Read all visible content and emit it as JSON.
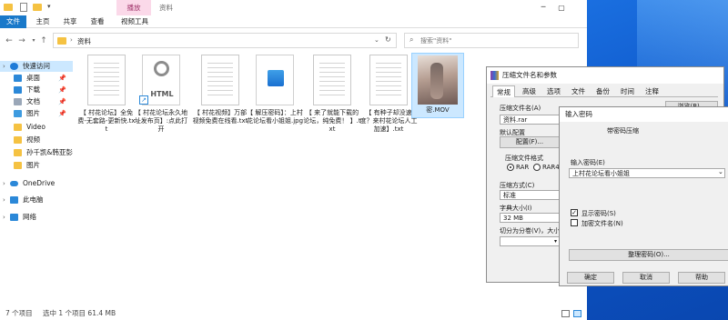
{
  "explorer": {
    "title": "资料",
    "playback_tab": "播放",
    "ribbon_tabs": [
      "文件",
      "主页",
      "共享",
      "查看",
      "视频工具"
    ],
    "breadcrumb": "资料",
    "search_placeholder": "搜索\"资料\"",
    "sidebar": [
      {
        "label": "快速访问",
        "icon": "star-icon",
        "color": "#1e7bd8",
        "pinned": false
      },
      {
        "label": "桌面",
        "icon": "desktop-icon",
        "color": "#2b88d8",
        "pinned": true
      },
      {
        "label": "下载",
        "icon": "download-icon",
        "color": "#2b88d8",
        "pinned": true
      },
      {
        "label": "文档",
        "icon": "documents-icon",
        "color": "#9aa7b8",
        "pinned": true
      },
      {
        "label": "图片",
        "icon": "pictures-icon",
        "color": "#3e9be0",
        "pinned": true
      },
      {
        "label": "Video",
        "icon": "folder-icon",
        "color": "#f5c242",
        "pinned": false
      },
      {
        "label": "视频",
        "icon": "folder-icon",
        "color": "#f5c242",
        "pinned": false
      },
      {
        "label": "孙千凯&韩亚彭",
        "icon": "folder-icon",
        "color": "#f5c242",
        "pinned": false
      },
      {
        "label": "图片",
        "icon": "folder-icon",
        "color": "#f5c242",
        "pinned": false
      },
      {
        "label": "OneDrive",
        "icon": "onedrive-icon",
        "color": "#2b88d8",
        "pinned": false
      },
      {
        "label": "此电脑",
        "icon": "this-pc-icon",
        "color": "#2b88d8",
        "pinned": false
      },
      {
        "label": "网络",
        "icon": "network-icon",
        "color": "#2b88d8",
        "pinned": false
      }
    ],
    "files": [
      {
        "name": "【 村花论坛】全免费-无套路-更新快.txt",
        "type": "txt"
      },
      {
        "name": "【 村花论坛永久地址发布页】:点此打开",
        "type": "html",
        "badge": "HTML"
      },
      {
        "name": "【 村花视频】万部视频免费在线看.txt",
        "type": "txt"
      },
      {
        "name": "【 解压密码】：上村花论坛看小姐姐.jpg",
        "type": "jpg"
      },
      {
        "name": "【 来了就能下载的论坛，纯免费！ 】.txt",
        "type": "txt"
      },
      {
        "name": "【 有种子却没速度？来村花论坛人工加速】.txt",
        "type": "txt"
      },
      {
        "name": "密.MOV",
        "type": "mov"
      }
    ],
    "status": {
      "count": "7 个项目",
      "selected": "选中 1 个项目  61.4 MB"
    }
  },
  "winrar_dialog": {
    "title": "压缩文件名和参数",
    "tabs": [
      "常规",
      "高级",
      "选项",
      "文件",
      "备份",
      "时间",
      "注释"
    ],
    "archive_name_label": "压缩文件名(A)",
    "archive_name_value": "资料.rar",
    "browse_button": "浏览(B)...",
    "default_profile_label": "默认配置",
    "profiles_button": "配置(F)...",
    "format_label": "压缩文件格式",
    "format_options": [
      "RAR",
      "RAR4"
    ],
    "format_selected": "RAR",
    "method_label": "压缩方式(C)",
    "method_value": "标准",
    "dict_label": "字典大小(I)",
    "dict_value": "32 MB",
    "split_label": "切分为分卷(V)，大小"
  },
  "password_dialog": {
    "title": "输入密码",
    "heading": "带密码压缩",
    "enter_label": "输入密码(E)",
    "password_value": "上村花论坛看小姐姐",
    "show_password_label": "显示密码(S)",
    "show_password_checked": true,
    "encrypt_names_label": "加密文件名(N)",
    "encrypt_names_checked": false,
    "organize_button": "整理密码(O)...",
    "ok_button": "确定",
    "cancel_button": "取消",
    "help_button": "帮助"
  },
  "colors": {
    "desktop": "#0a5fd0",
    "ribbon_file_tab": "#1979ca",
    "contextual_tab": "#fbd9e9",
    "selected_row": "#cce8ff"
  }
}
